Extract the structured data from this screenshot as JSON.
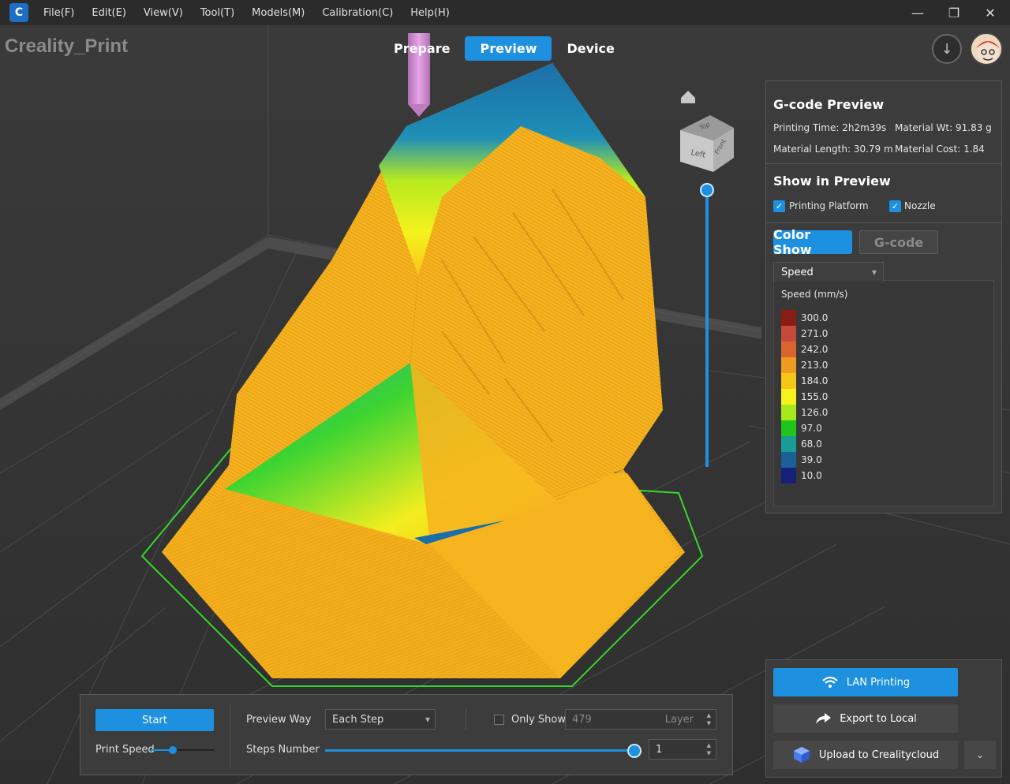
{
  "window": {
    "menus": [
      "File(F)",
      "Edit(E)",
      "View(V)",
      "Tool(T)",
      "Models(M)",
      "Calibration(C)",
      "Help(H)"
    ],
    "minimize": "—",
    "restore": "❐",
    "close": "✕"
  },
  "app_title": "Creality_Print",
  "main_tabs": {
    "prepare": "Prepare",
    "preview": "Preview",
    "device": "Device",
    "active": "Preview"
  },
  "view_cube": {
    "face_top": "Top",
    "face_left": "Left",
    "face_front": "Front"
  },
  "gcode_preview": {
    "title": "G-code Preview",
    "printing_time": "Printing Time: 2h2m39s",
    "material_wt": "Material Wt: 91.83 g",
    "material_length": "Material Length: 30.79 m",
    "material_cost": "Material Cost: 1.84"
  },
  "show_in_preview": {
    "title": "Show in Preview",
    "printing_platform": {
      "label": "Printing Platform",
      "checked": true
    },
    "nozzle": {
      "label": "Nozzle",
      "checked": true
    }
  },
  "color_mode": {
    "color_show": "Color Show",
    "gcode": "G-code",
    "selected": "Color Show"
  },
  "legend": {
    "dropdown_value": "Speed",
    "unit_label": "Speed (mm/s)",
    "entries": [
      {
        "value": "300.0",
        "color": "#8a1d13"
      },
      {
        "value": "271.0",
        "color": "#c44a3a"
      },
      {
        "value": "242.0",
        "color": "#d9652e"
      },
      {
        "value": "213.0",
        "color": "#ef9a23"
      },
      {
        "value": "184.0",
        "color": "#f6c617"
      },
      {
        "value": "155.0",
        "color": "#f5f21d"
      },
      {
        "value": "126.0",
        "color": "#a6e81d"
      },
      {
        "value": "97.0",
        "color": "#1ec61b"
      },
      {
        "value": "68.0",
        "color": "#1a9c96"
      },
      {
        "value": "39.0",
        "color": "#1b5f99"
      },
      {
        "value": "10.0",
        "color": "#16207a"
      }
    ]
  },
  "bottom_controls": {
    "start": "Start",
    "print_speed": "Print Speed",
    "print_speed_level": 0.35,
    "preview_way_label": "Preview Way",
    "preview_way_value": "Each Step",
    "only_show": "Only Show",
    "layer_value": "479",
    "layer_unit": "Layer",
    "steps_number": "Steps Number",
    "steps_level": 1.0,
    "steps_value": "1"
  },
  "export": {
    "lan_printing": "LAN Printing",
    "export_local": "Export to Local",
    "upload_cloud": "Upload to Crealitycloud"
  },
  "colors": {
    "accent": "#1e90e0",
    "bed_outline": "#35d82a",
    "model_main": "#f5b01f"
  }
}
